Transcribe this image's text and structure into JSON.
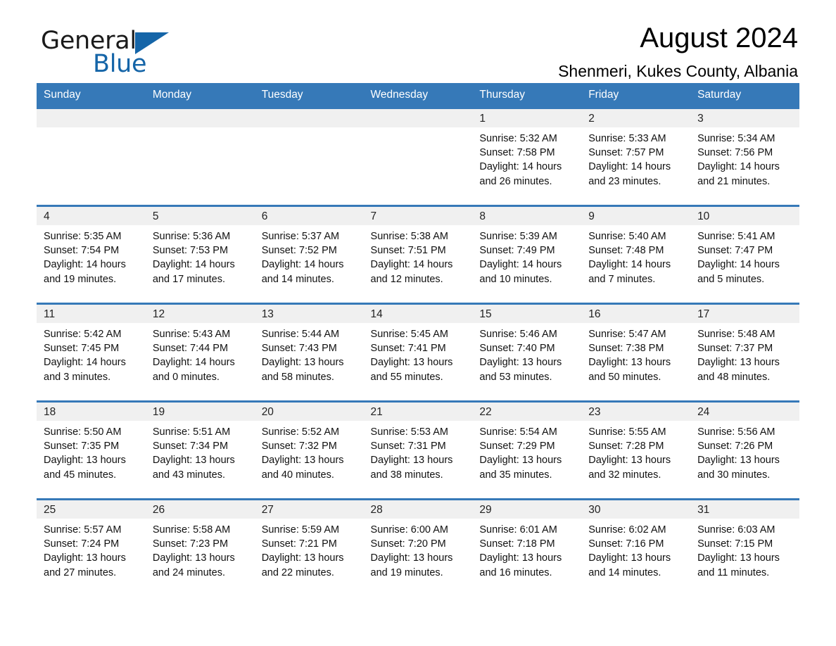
{
  "logo": {
    "word1": "General",
    "word2": "Blue",
    "triangle_color": "#1565a8",
    "word1_color": "#1a1a1a",
    "word2_color": "#1565a8"
  },
  "header": {
    "month_title": "August 2024",
    "location": "Shenmeri, Kukes County, Albania"
  },
  "theme": {
    "header_blue": "#3679b8",
    "daynum_band": "#f0f0f0",
    "cell_background": "#ffffff",
    "text": "#111111"
  },
  "weekday_headers": [
    "Sunday",
    "Monday",
    "Tuesday",
    "Wednesday",
    "Thursday",
    "Friday",
    "Saturday"
  ],
  "weeks": [
    [
      {
        "day": "",
        "empty": true
      },
      {
        "day": "",
        "empty": true
      },
      {
        "day": "",
        "empty": true
      },
      {
        "day": "",
        "empty": true
      },
      {
        "day": "1",
        "sunrise": "Sunrise: 5:32 AM",
        "sunset": "Sunset: 7:58 PM",
        "daylight1": "Daylight: 14 hours",
        "daylight2": "and 26 minutes."
      },
      {
        "day": "2",
        "sunrise": "Sunrise: 5:33 AM",
        "sunset": "Sunset: 7:57 PM",
        "daylight1": "Daylight: 14 hours",
        "daylight2": "and 23 minutes."
      },
      {
        "day": "3",
        "sunrise": "Sunrise: 5:34 AM",
        "sunset": "Sunset: 7:56 PM",
        "daylight1": "Daylight: 14 hours",
        "daylight2": "and 21 minutes."
      }
    ],
    [
      {
        "day": "4",
        "sunrise": "Sunrise: 5:35 AM",
        "sunset": "Sunset: 7:54 PM",
        "daylight1": "Daylight: 14 hours",
        "daylight2": "and 19 minutes."
      },
      {
        "day": "5",
        "sunrise": "Sunrise: 5:36 AM",
        "sunset": "Sunset: 7:53 PM",
        "daylight1": "Daylight: 14 hours",
        "daylight2": "and 17 minutes."
      },
      {
        "day": "6",
        "sunrise": "Sunrise: 5:37 AM",
        "sunset": "Sunset: 7:52 PM",
        "daylight1": "Daylight: 14 hours",
        "daylight2": "and 14 minutes."
      },
      {
        "day": "7",
        "sunrise": "Sunrise: 5:38 AM",
        "sunset": "Sunset: 7:51 PM",
        "daylight1": "Daylight: 14 hours",
        "daylight2": "and 12 minutes."
      },
      {
        "day": "8",
        "sunrise": "Sunrise: 5:39 AM",
        "sunset": "Sunset: 7:49 PM",
        "daylight1": "Daylight: 14 hours",
        "daylight2": "and 10 minutes."
      },
      {
        "day": "9",
        "sunrise": "Sunrise: 5:40 AM",
        "sunset": "Sunset: 7:48 PM",
        "daylight1": "Daylight: 14 hours",
        "daylight2": "and 7 minutes."
      },
      {
        "day": "10",
        "sunrise": "Sunrise: 5:41 AM",
        "sunset": "Sunset: 7:47 PM",
        "daylight1": "Daylight: 14 hours",
        "daylight2": "and 5 minutes."
      }
    ],
    [
      {
        "day": "11",
        "sunrise": "Sunrise: 5:42 AM",
        "sunset": "Sunset: 7:45 PM",
        "daylight1": "Daylight: 14 hours",
        "daylight2": "and 3 minutes."
      },
      {
        "day": "12",
        "sunrise": "Sunrise: 5:43 AM",
        "sunset": "Sunset: 7:44 PM",
        "daylight1": "Daylight: 14 hours",
        "daylight2": "and 0 minutes."
      },
      {
        "day": "13",
        "sunrise": "Sunrise: 5:44 AM",
        "sunset": "Sunset: 7:43 PM",
        "daylight1": "Daylight: 13 hours",
        "daylight2": "and 58 minutes."
      },
      {
        "day": "14",
        "sunrise": "Sunrise: 5:45 AM",
        "sunset": "Sunset: 7:41 PM",
        "daylight1": "Daylight: 13 hours",
        "daylight2": "and 55 minutes."
      },
      {
        "day": "15",
        "sunrise": "Sunrise: 5:46 AM",
        "sunset": "Sunset: 7:40 PM",
        "daylight1": "Daylight: 13 hours",
        "daylight2": "and 53 minutes."
      },
      {
        "day": "16",
        "sunrise": "Sunrise: 5:47 AM",
        "sunset": "Sunset: 7:38 PM",
        "daylight1": "Daylight: 13 hours",
        "daylight2": "and 50 minutes."
      },
      {
        "day": "17",
        "sunrise": "Sunrise: 5:48 AM",
        "sunset": "Sunset: 7:37 PM",
        "daylight1": "Daylight: 13 hours",
        "daylight2": "and 48 minutes."
      }
    ],
    [
      {
        "day": "18",
        "sunrise": "Sunrise: 5:50 AM",
        "sunset": "Sunset: 7:35 PM",
        "daylight1": "Daylight: 13 hours",
        "daylight2": "and 45 minutes."
      },
      {
        "day": "19",
        "sunrise": "Sunrise: 5:51 AM",
        "sunset": "Sunset: 7:34 PM",
        "daylight1": "Daylight: 13 hours",
        "daylight2": "and 43 minutes."
      },
      {
        "day": "20",
        "sunrise": "Sunrise: 5:52 AM",
        "sunset": "Sunset: 7:32 PM",
        "daylight1": "Daylight: 13 hours",
        "daylight2": "and 40 minutes."
      },
      {
        "day": "21",
        "sunrise": "Sunrise: 5:53 AM",
        "sunset": "Sunset: 7:31 PM",
        "daylight1": "Daylight: 13 hours",
        "daylight2": "and 38 minutes."
      },
      {
        "day": "22",
        "sunrise": "Sunrise: 5:54 AM",
        "sunset": "Sunset: 7:29 PM",
        "daylight1": "Daylight: 13 hours",
        "daylight2": "and 35 minutes."
      },
      {
        "day": "23",
        "sunrise": "Sunrise: 5:55 AM",
        "sunset": "Sunset: 7:28 PM",
        "daylight1": "Daylight: 13 hours",
        "daylight2": "and 32 minutes."
      },
      {
        "day": "24",
        "sunrise": "Sunrise: 5:56 AM",
        "sunset": "Sunset: 7:26 PM",
        "daylight1": "Daylight: 13 hours",
        "daylight2": "and 30 minutes."
      }
    ],
    [
      {
        "day": "25",
        "sunrise": "Sunrise: 5:57 AM",
        "sunset": "Sunset: 7:24 PM",
        "daylight1": "Daylight: 13 hours",
        "daylight2": "and 27 minutes."
      },
      {
        "day": "26",
        "sunrise": "Sunrise: 5:58 AM",
        "sunset": "Sunset: 7:23 PM",
        "daylight1": "Daylight: 13 hours",
        "daylight2": "and 24 minutes."
      },
      {
        "day": "27",
        "sunrise": "Sunrise: 5:59 AM",
        "sunset": "Sunset: 7:21 PM",
        "daylight1": "Daylight: 13 hours",
        "daylight2": "and 22 minutes."
      },
      {
        "day": "28",
        "sunrise": "Sunrise: 6:00 AM",
        "sunset": "Sunset: 7:20 PM",
        "daylight1": "Daylight: 13 hours",
        "daylight2": "and 19 minutes."
      },
      {
        "day": "29",
        "sunrise": "Sunrise: 6:01 AM",
        "sunset": "Sunset: 7:18 PM",
        "daylight1": "Daylight: 13 hours",
        "daylight2": "and 16 minutes."
      },
      {
        "day": "30",
        "sunrise": "Sunrise: 6:02 AM",
        "sunset": "Sunset: 7:16 PM",
        "daylight1": "Daylight: 13 hours",
        "daylight2": "and 14 minutes."
      },
      {
        "day": "31",
        "sunrise": "Sunrise: 6:03 AM",
        "sunset": "Sunset: 7:15 PM",
        "daylight1": "Daylight: 13 hours",
        "daylight2": "and 11 minutes."
      }
    ]
  ]
}
